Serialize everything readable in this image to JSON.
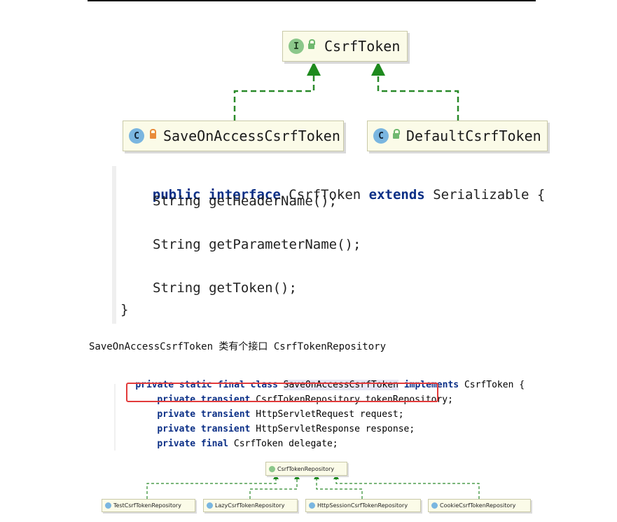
{
  "top_diagram": {
    "interface": {
      "badge": "I",
      "name": "CsrfToken"
    },
    "impl_left": {
      "badge": "C",
      "name": "SaveOnAccessCsrfToken"
    },
    "impl_right": {
      "badge": "C",
      "name": "DefaultCsrfToken"
    }
  },
  "code_block_1": {
    "line1_kw1": "public",
    "line1_kw2": "interface",
    "line1_name": "CsrfToken",
    "line1_kw3": "extends",
    "line1_rest": "Serializable {",
    "line2": "String getHeaderName();",
    "line3": "String getParameterName();",
    "line4": "String getToken();",
    "line5": "}"
  },
  "caption": "SaveOnAccessCsrfToken 类有个接口 CsrfTokenRepository",
  "code_block_2": {
    "l1_kw": "private static final class",
    "l1_name": "SaveOnAccessCsrfToken",
    "l1_impl": "implements",
    "l1_rest": "CsrfToken {",
    "l2_kw": "private transient",
    "l2_rest": "CsrfTokenRepository tokenRepository;",
    "l3_kw": "private transient",
    "l3_rest": "HttpServletRequest request;",
    "l4_kw": "private transient",
    "l4_rest": "HttpServletResponse response;",
    "l5_kw": "private final",
    "l5_rest": "CsrfToken delegate;"
  },
  "bottom_diagram": {
    "interface": "CsrfTokenRepository",
    "impls": [
      "TestCsrfTokenRepository",
      "LazyCsrfTokenRepository",
      "HttpSessionCsrfTokenRepository",
      "CookieCsrfTokenRepository"
    ]
  },
  "colors": {
    "keyword": "#0b2f86",
    "arrow_green": "#1e8a1e",
    "highlight_box": "#e23b3b",
    "uml_box_bg": "#fbfbe8"
  }
}
